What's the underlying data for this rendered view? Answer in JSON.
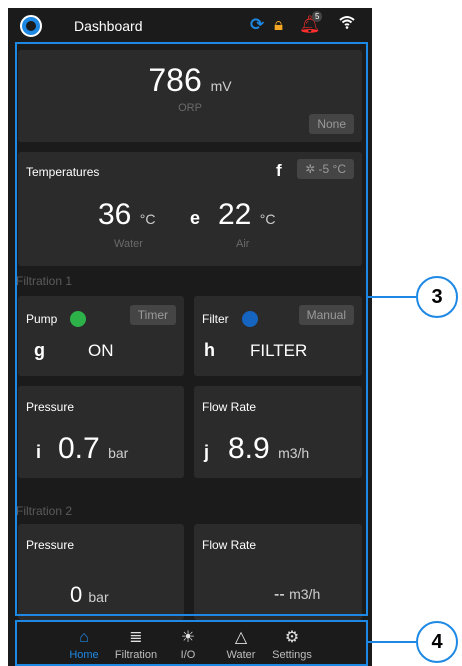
{
  "statusbar": {
    "title": "Dashboard",
    "icons": [
      "sync-icon",
      "lock-icon",
      "bell-icon",
      "wifi-icon"
    ],
    "bell_badge": "5"
  },
  "orp": {
    "value": "786",
    "unit": "mV",
    "label": "ORP",
    "chip": "None"
  },
  "temperatures": {
    "title": "Temperatures",
    "f_letter": "f",
    "chip": "-5 °C",
    "chip_icon": "snowflake-icon",
    "water_value": "36",
    "water_unit": "°C",
    "water_label": "Water",
    "e_letter": "e",
    "air_value": "22",
    "air_unit": "°C",
    "air_label": "Air"
  },
  "filtration1": {
    "label": "Filtration 1",
    "pump": {
      "title": "Pump",
      "status_color": "#2db24a",
      "chip": "Timer",
      "letter": "g",
      "state": "ON"
    },
    "filter": {
      "title": "Filter",
      "status_color": "#1565c0",
      "chip": "Manual",
      "letter": "h",
      "state": "FILTER"
    },
    "pressure": {
      "title": "Pressure",
      "letter": "i",
      "value": "0.7",
      "unit": "bar"
    },
    "flow": {
      "title": "Flow Rate",
      "letter": "j",
      "value": "8.9",
      "unit": "m3/h"
    }
  },
  "filtration2": {
    "label": "Filtration 2",
    "pressure": {
      "title": "Pressure",
      "value": "0",
      "unit": "bar"
    },
    "flow": {
      "title": "Flow Rate",
      "value": "--",
      "unit": "m3/h"
    }
  },
  "nav": {
    "items": [
      {
        "label": "Home",
        "icon": "home-icon",
        "active": true
      },
      {
        "label": "Filtration",
        "icon": "filtration-icon",
        "active": false
      },
      {
        "label": "I/O",
        "icon": "bulb-icon",
        "active": false
      },
      {
        "label": "Water",
        "icon": "flask-icon",
        "active": false
      },
      {
        "label": "Settings",
        "icon": "gear-icon",
        "active": false
      }
    ]
  },
  "callouts": {
    "content_number": "3",
    "nav_number": "4"
  },
  "colors": {
    "accent": "#1e88e5",
    "background": "#1b1b1b",
    "card": "#2b2b2b"
  }
}
